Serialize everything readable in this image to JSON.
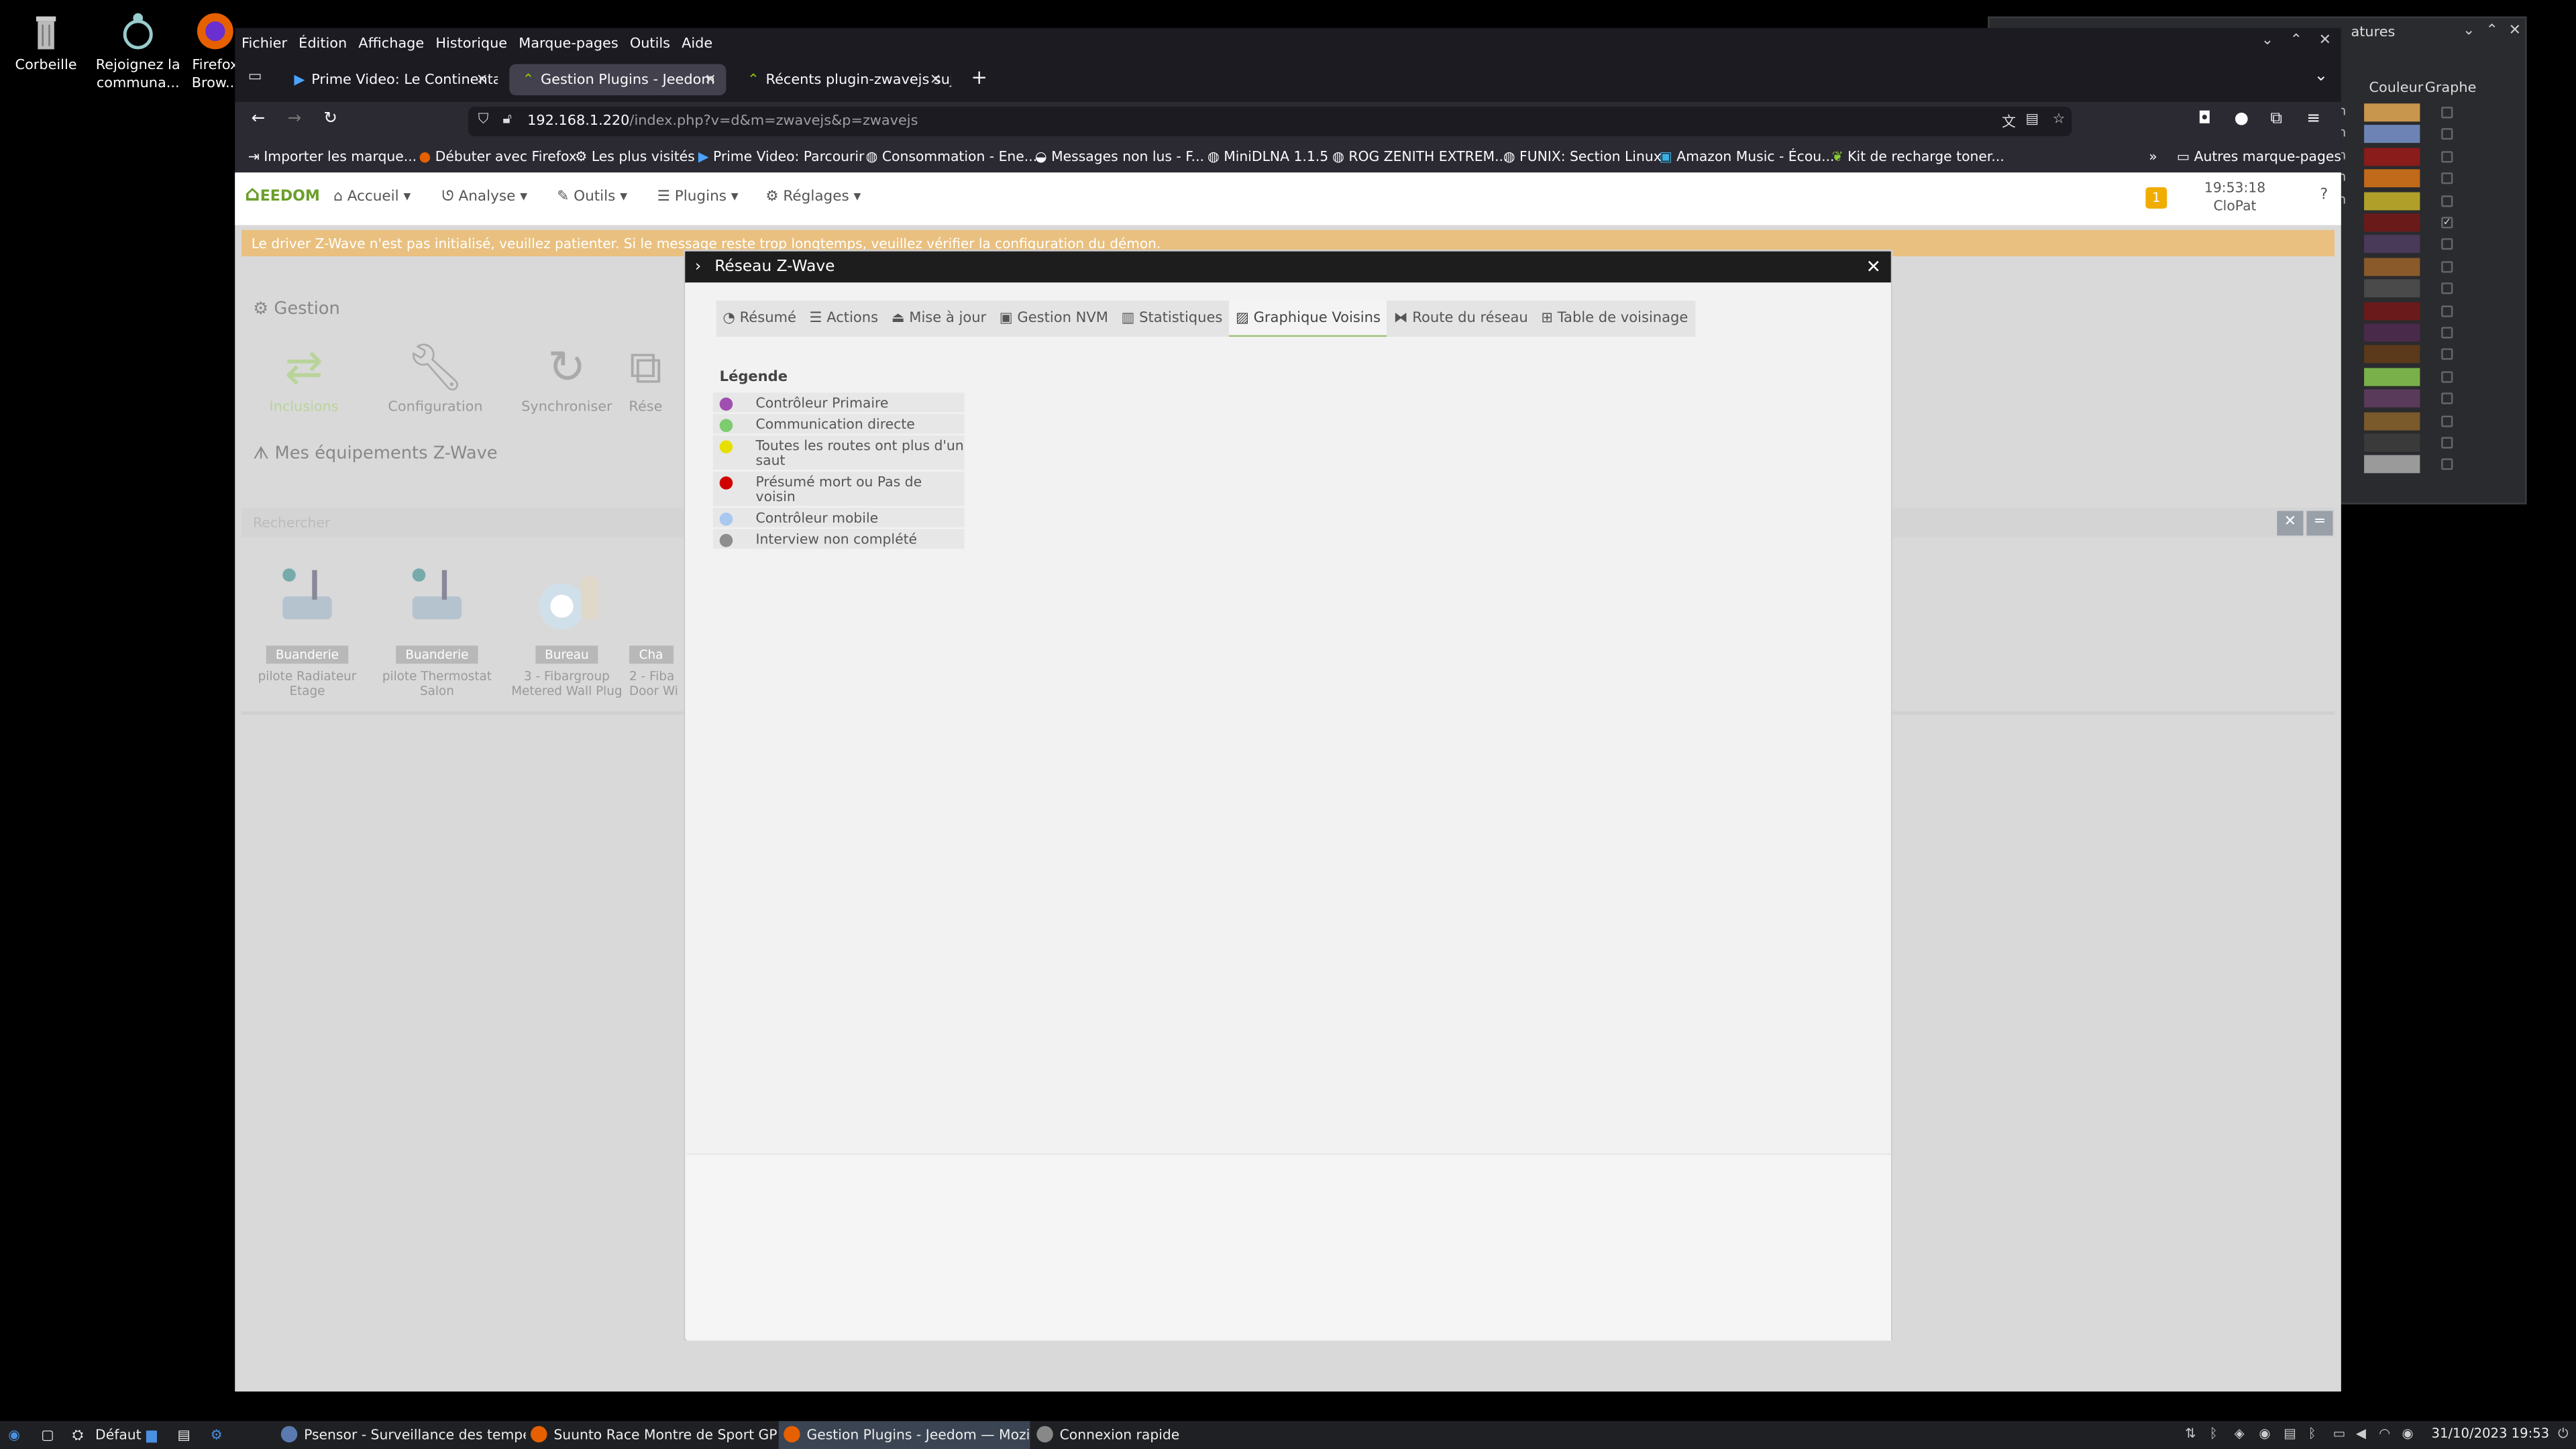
{
  "desktop": {
    "icons": [
      {
        "label": "Corbeille"
      },
      {
        "label": "Rejoignez la communa..."
      },
      {
        "label": "Firefox Brow..."
      }
    ]
  },
  "bg_window": {
    "title_fragment": "atures",
    "col_couleur": "Couleur",
    "col_graphe": "Graphe",
    "row_prefix": "n",
    "swatches": [
      "#c8964c",
      "#6e83b5",
      "#8a1c1c",
      "#c06a1a",
      "#b0a02a",
      "#6b1a1a",
      "#4a3a5a",
      "#8a5a2a",
      "#4a4a4a",
      "#6a1a1a",
      "#4a2a4a",
      "#5a3a1a",
      "#7ab04a",
      "#5a3a5a",
      "#7a5a2a",
      "#3a3a3a",
      "#9a9a9a"
    ],
    "checked_index": 5
  },
  "menu": [
    "Fichier",
    "Édition",
    "Affichage",
    "Historique",
    "Marque-pages",
    "Outils",
    "Aide"
  ],
  "tabs": [
    {
      "label": "Prime Video: Le Continental"
    },
    {
      "label": "Gestion Plugins - Jeedom"
    },
    {
      "label": "Récents plugin-zwavejs sujet"
    }
  ],
  "url": {
    "host": "192.168.1.220",
    "path": "/index.php?v=d&m=zwavejs&p=zwavejs"
  },
  "bookmarks": [
    "Importer les marque...",
    "Débuter avec Firefox",
    "Les plus visités",
    "Prime Video: Parcourir",
    "Consommation - Ene...",
    "Messages non lus - F...",
    "MiniDLNA 1.1.5",
    "ROG ZENITH EXTREM...",
    "FUNIX: Section Linux",
    "Amazon Music - Écou...",
    "Kit de recharge toner...",
    "Autres marque-pages"
  ],
  "jeedom": {
    "logo": "EEDOM",
    "menus": [
      "Accueil",
      "Analyse",
      "Outils",
      "Plugins",
      "Réglages"
    ],
    "notif_count": "1",
    "time": "19:53:18",
    "user": "CloPat",
    "warning": "Le driver Z-Wave n'est pas initialisé, veuillez patienter. Si le message reste trop longtemps, veuillez vérifier la configuration du démon.",
    "gestion_title": "Gestion",
    "gestion_buttons": [
      "Inclusions",
      "Configuration",
      "Synchroniser",
      "Rése"
    ],
    "equip_title": "Mes équipements Z-Wave",
    "search_placeholder": "Rechercher",
    "cards": [
      {
        "loc": "Buanderie",
        "name": "pilote Radiateur Etage"
      },
      {
        "loc": "Buanderie",
        "name": "pilote Thermostat Salon"
      },
      {
        "loc": "Bureau",
        "name": "3 - Fibargroup Metered Wall Plug"
      },
      {
        "loc": "Cha",
        "name": "2 - Fiba Door Wi"
      }
    ]
  },
  "modal": {
    "title": "Réseau Z-Wave",
    "tabs": [
      "Résumé",
      "Actions",
      "Mise à jour",
      "Gestion NVM",
      "Statistiques",
      "Graphique Voisins",
      "Route du réseau",
      "Table de voisinage"
    ],
    "active_tab": "Graphique Voisins",
    "legend_title": "Légende",
    "legend": [
      {
        "label": "Contrôleur Primaire",
        "color": "#a04fb0"
      },
      {
        "label": "Communication directe",
        "color": "#7dcc6f"
      },
      {
        "label": "Toutes les routes ont plus d'un saut",
        "color": "#e6e000"
      },
      {
        "label": "Présumé mort ou Pas de voisin",
        "color": "#d00000"
      },
      {
        "label": "Contrôleur mobile",
        "color": "#a8c8f0"
      },
      {
        "label": "Interview non complété",
        "color": "#8e8e8e"
      }
    ]
  },
  "taskbar": {
    "layout": "Défaut",
    "apps": [
      {
        "label": "Psensor - Surveillance des tempéra..."
      },
      {
        "label": "Suunto Race Montre de Sport GPS ..."
      },
      {
        "label": "Gestion Plugins - Jeedom — Mozill..."
      },
      {
        "label": "Connexion rapide"
      }
    ],
    "datetime": "31/10/2023  19:53"
  }
}
